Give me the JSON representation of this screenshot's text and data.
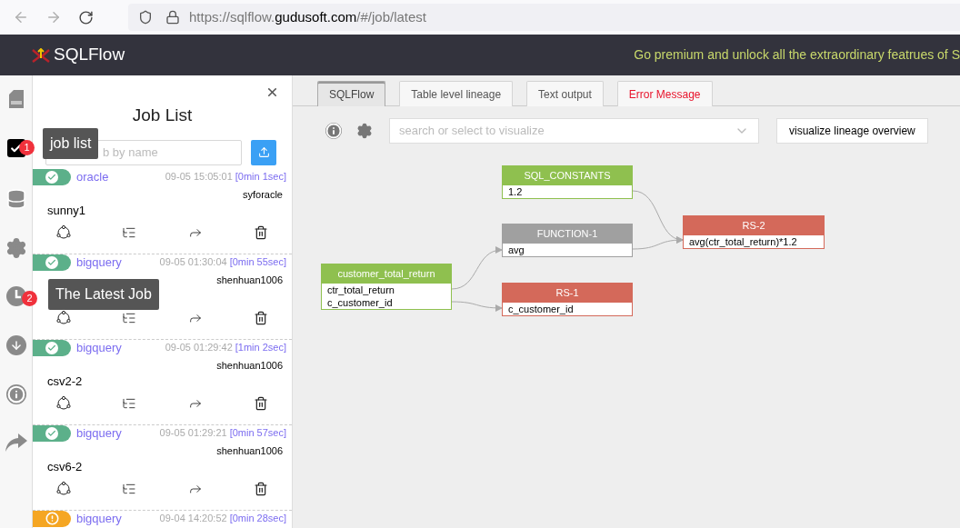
{
  "browser": {
    "url": {
      "scheme": "https://sqlflow.",
      "domain": "gudusoft.com",
      "path": "/#/job/latest"
    }
  },
  "header": {
    "logo": "SQLFlow",
    "promo": "Go premium and unlock all the extraordinary featrues of S"
  },
  "sidebar": {
    "items": [
      {
        "kind": "sql",
        "selected": false
      },
      {
        "kind": "jobs",
        "selected": true,
        "badge": "1",
        "tooltip": "job list"
      },
      {
        "kind": "database",
        "selected": false
      },
      {
        "kind": "settings",
        "selected": false
      },
      {
        "kind": "latest",
        "selected": false,
        "badge": "2",
        "tooltip": "The Latest Job"
      },
      {
        "kind": "download",
        "selected": false
      },
      {
        "kind": "info",
        "selected": false
      },
      {
        "kind": "share",
        "selected": false
      }
    ]
  },
  "job_panel": {
    "title": "Job List",
    "search": {
      "placeholder": "b by name"
    },
    "jobs": [
      {
        "kind": "success",
        "db": "oracle",
        "time": "09-05 15:05:01",
        "duration": "[0min 1sec]",
        "user": "syforacle",
        "name": "sunny1"
      },
      {
        "kind": "success",
        "db": "bigquery",
        "time": "09-05 01:30:04",
        "duration": "[0min 55sec]",
        "user": "shenhuan1006"
      },
      {
        "kind": "success",
        "db": "bigquery",
        "time": "09-05 01:29:42",
        "duration": "[1min 2sec]",
        "user": "shenhuan1006",
        "name": "csv2-2"
      },
      {
        "kind": "success",
        "db": "bigquery",
        "time": "09-05 01:29:21",
        "duration": "[0min 57sec]",
        "user": "shenhuan1006",
        "name": "csv6-2"
      },
      {
        "kind": "warning",
        "db": "bigquery",
        "time": "09-04 14:20:52",
        "duration": "[0min 28sec]"
      }
    ]
  },
  "tabs": [
    {
      "label": "SQLFlow",
      "selected": true,
      "kind": "normal"
    },
    {
      "label": "Table level lineage",
      "selected": false,
      "kind": "normal"
    },
    {
      "label": "Text output",
      "selected": false,
      "kind": "normal"
    },
    {
      "label": "Error Message",
      "selected": false,
      "kind": "error"
    }
  ],
  "toolbar": {
    "select": {
      "placeholder": "search or select to visualize"
    },
    "button": "visualize lineage overview"
  },
  "diagram": {
    "nodes": [
      {
        "kind": "table",
        "title": "customer_total_return",
        "rows": [
          "ctr_total_return",
          "c_customer_id"
        ]
      },
      {
        "kind": "table",
        "title": "SQL_CONSTANTS",
        "rows": [
          "1.2"
        ]
      },
      {
        "kind": "function",
        "title": "FUNCTION-1",
        "rows": [
          "avg"
        ]
      },
      {
        "kind": "result",
        "title": "RS-1",
        "rows": [
          "c_customer_id"
        ]
      },
      {
        "kind": "result",
        "title": "RS-2",
        "rows": [
          "avg(ctr_total_return)*1.2"
        ]
      }
    ]
  }
}
